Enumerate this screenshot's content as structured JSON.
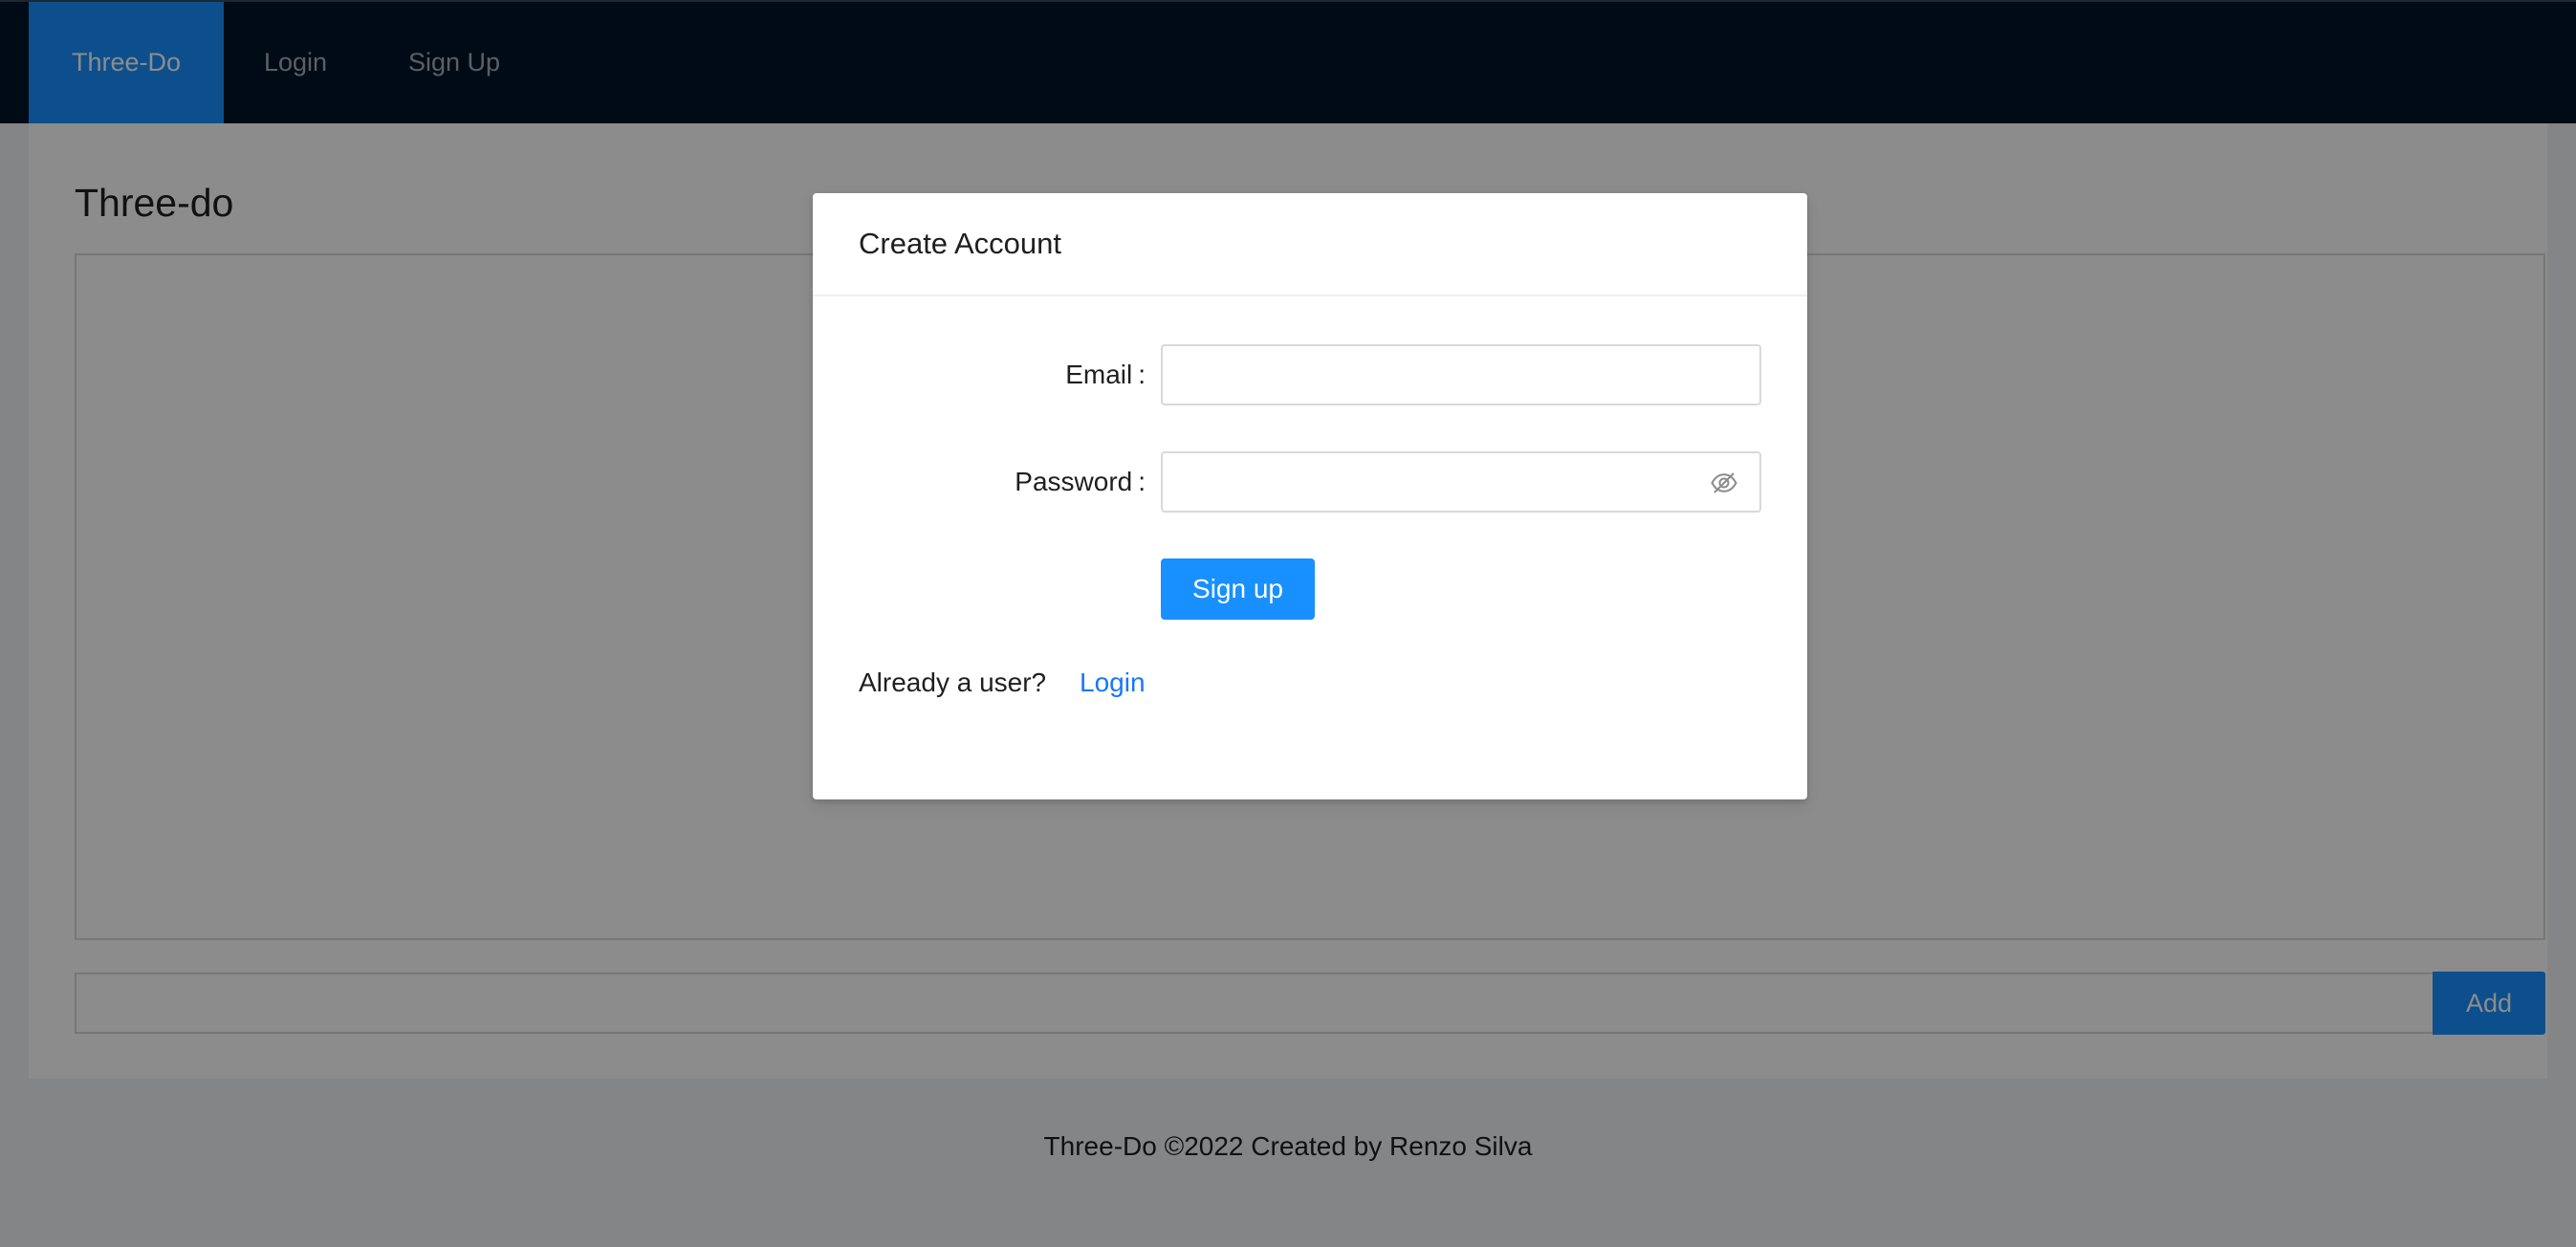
{
  "nav": {
    "items": [
      {
        "label": "Three-Do",
        "active": true
      },
      {
        "label": "Login",
        "active": false
      },
      {
        "label": "Sign Up",
        "active": false
      }
    ]
  },
  "main": {
    "title": "Three-do",
    "add_input_value": "",
    "add_button_label": "Add"
  },
  "footer": {
    "text": "Three-Do ©2022 Created by Renzo Silva"
  },
  "modal": {
    "title": "Create Account",
    "email_label": "Email",
    "email_value": "",
    "password_label": "Password",
    "password_value": "",
    "password_toggle_icon": "eye-invisible-icon",
    "submit_label": "Sign up",
    "already_user_text": "Already a user?",
    "login_link": "Login"
  },
  "colors": {
    "nav_bg": "#001529",
    "primary": "#1890ff",
    "link": "#1677ff",
    "overlay": "rgba(0,0,0,0.45)"
  }
}
